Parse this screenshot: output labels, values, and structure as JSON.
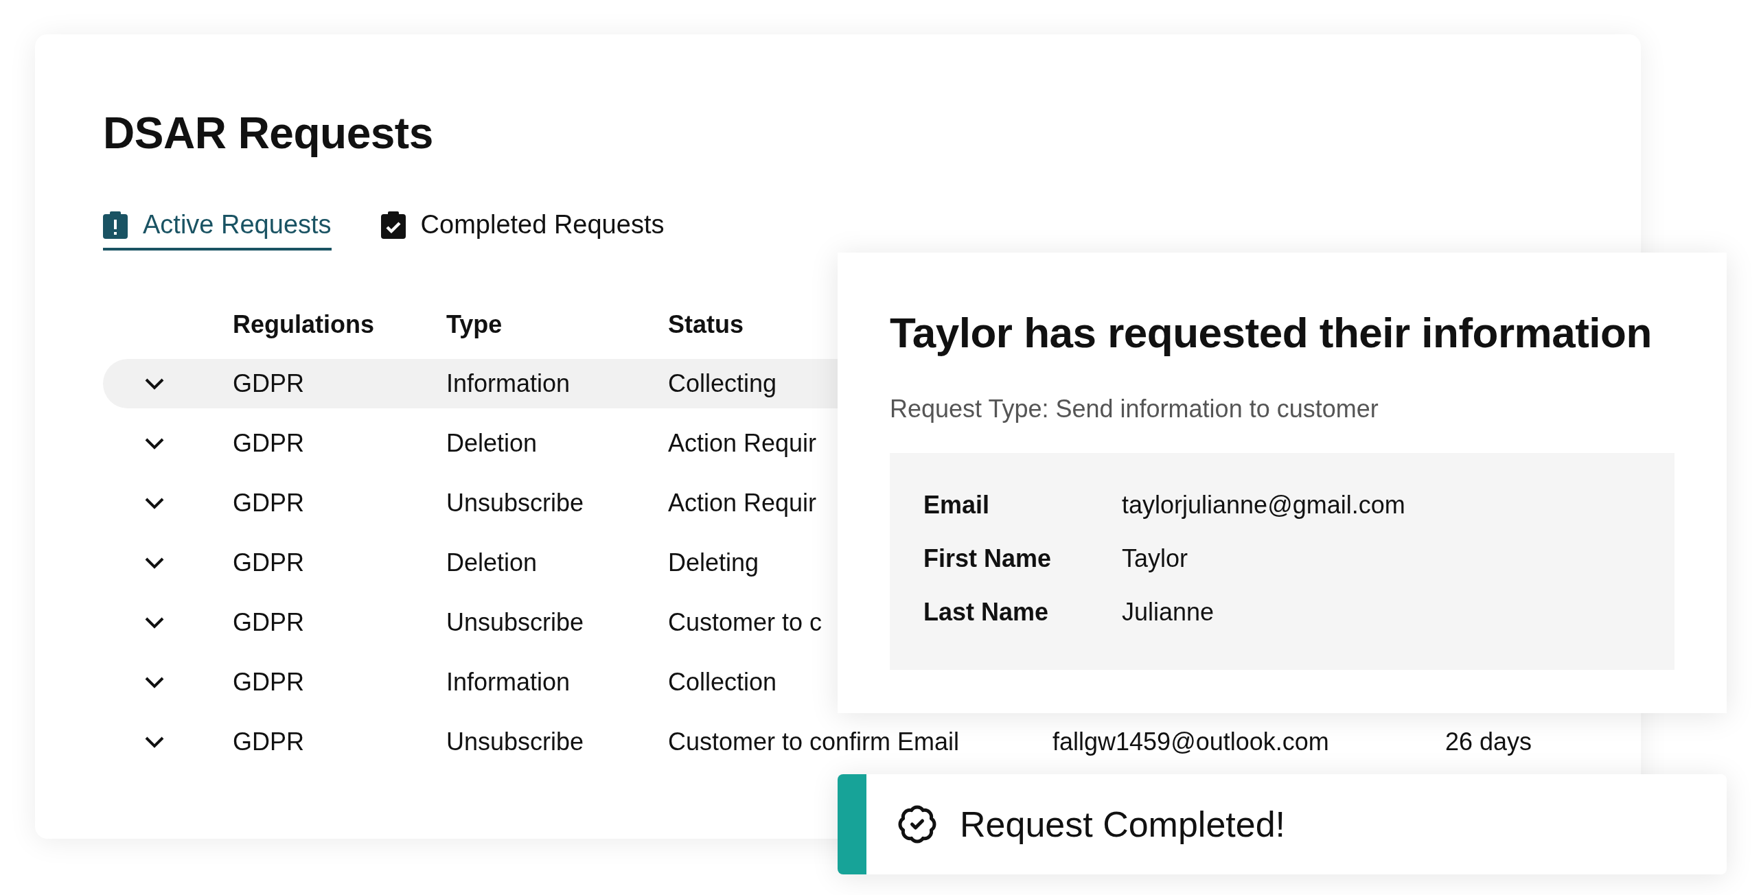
{
  "title": "DSAR Requests",
  "tabs": [
    {
      "label": "Active Requests",
      "kind": "alert",
      "selected": true
    },
    {
      "label": "Completed Requests",
      "kind": "check",
      "selected": false
    }
  ],
  "table": {
    "columns": [
      "Regulations",
      "Type",
      "Status"
    ],
    "rows": [
      {
        "regulation": "GDPR",
        "type": "Information",
        "status": "Collecting",
        "selected": true
      },
      {
        "regulation": "GDPR",
        "type": "Deletion",
        "status": "Action Requir",
        "selected": false
      },
      {
        "regulation": "GDPR",
        "type": "Unsubscribe",
        "status": "Action Requir",
        "selected": false
      },
      {
        "regulation": "GDPR",
        "type": "Deletion",
        "status": "Deleting",
        "selected": false
      },
      {
        "regulation": "GDPR",
        "type": "Unsubscribe",
        "status": "Customer to c",
        "selected": false
      },
      {
        "regulation": "GDPR",
        "type": "Information",
        "status": "Collection",
        "selected": false
      },
      {
        "regulation": "GDPR",
        "type": "Unsubscribe",
        "status": "Customer to confirm Email",
        "email": "fallgw1459@outlook.com",
        "age": "26 days",
        "selected": false
      }
    ]
  },
  "detail": {
    "title": "Taylor has requested their information",
    "subtitle": "Request Type: Send information to customer",
    "fields": [
      {
        "label": "Email",
        "value": "taylorjulianne@gmail.com"
      },
      {
        "label": "First Name",
        "value": "Taylor"
      },
      {
        "label": "Last Name",
        "value": "Julianne"
      }
    ]
  },
  "toast": {
    "message": "Request Completed!"
  }
}
